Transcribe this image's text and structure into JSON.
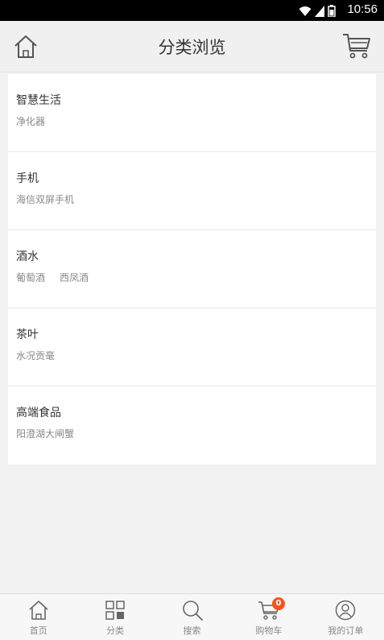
{
  "status_bar": {
    "time": "10:56"
  },
  "header": {
    "title": "分类浏览",
    "home_icon": "home-icon",
    "cart_icon": "cart-icon"
  },
  "categories": [
    {
      "name": "智慧生活",
      "subs": [
        "净化器"
      ]
    },
    {
      "name": "手机",
      "subs": [
        "海信双屏手机"
      ]
    },
    {
      "name": "酒水",
      "subs": [
        "葡萄酒",
        "西凤酒"
      ]
    },
    {
      "name": "茶叶",
      "subs": [
        "水况贡毫"
      ]
    },
    {
      "name": "高端食品",
      "subs": [
        "阳澄湖大闸蟹"
      ]
    }
  ],
  "tabbar": {
    "tabs": [
      {
        "label": "首页",
        "icon": "home-icon"
      },
      {
        "label": "分类",
        "icon": "grid-icon"
      },
      {
        "label": "搜索",
        "icon": "search-icon"
      },
      {
        "label": "购物车",
        "icon": "cart-icon",
        "badge": "0"
      },
      {
        "label": "我的订单",
        "icon": "user-icon"
      }
    ]
  },
  "colors": {
    "accent": "#f5541c",
    "header_bg": "#f0f0f0",
    "page_bg": "#f2f2f2"
  }
}
